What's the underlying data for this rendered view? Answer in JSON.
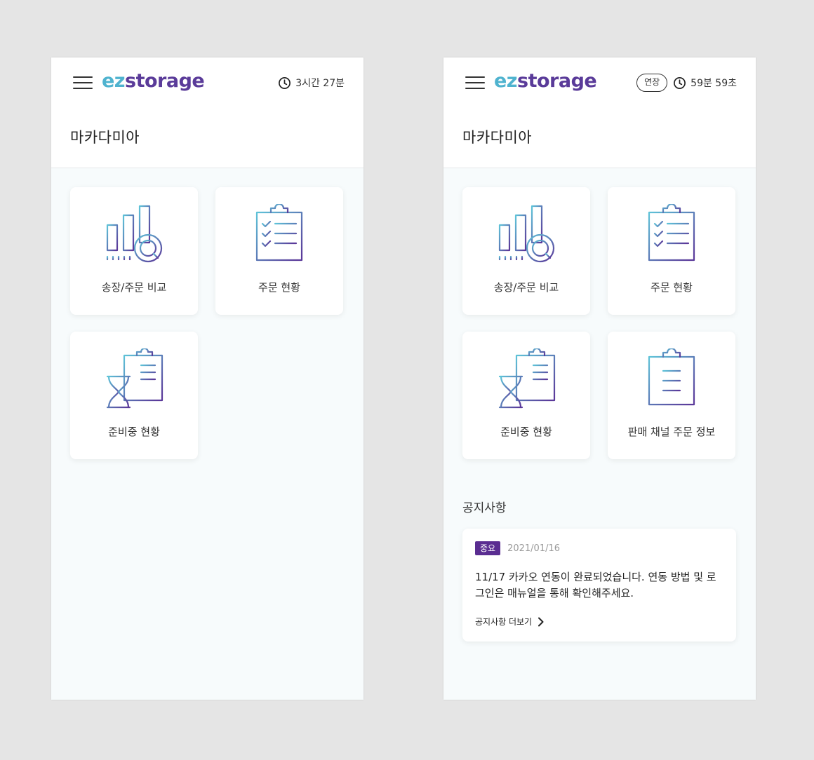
{
  "app": {
    "logo_ez": "ez",
    "logo_storage": "storage"
  },
  "colors": {
    "brand_teal": "#4fb3cf",
    "brand_purple": "#5a3b99",
    "badge_purple": "#5a2d91"
  },
  "left_screen": {
    "timer": "3시간 27분",
    "store_name": "마카다미아",
    "menu": [
      {
        "label": "송장/주문 비교",
        "icon": "bar-chart-search-icon"
      },
      {
        "label": "주문 현황",
        "icon": "clipboard-checklist-icon"
      },
      {
        "label": "준비중 현황",
        "icon": "hourglass-clipboard-icon"
      }
    ]
  },
  "right_screen": {
    "extend_label": "연장",
    "timer": "59분 59초",
    "store_name": "마카다미아",
    "menu": [
      {
        "label": "송장/주문 비교",
        "icon": "bar-chart-search-icon"
      },
      {
        "label": "주문 현황",
        "icon": "clipboard-checklist-icon"
      },
      {
        "label": "준비중 현황",
        "icon": "hourglass-clipboard-icon"
      },
      {
        "label": "판매 채널 주문 정보",
        "icon": "clipboard-lines-icon"
      }
    ],
    "notice": {
      "section_title": "공지사항",
      "badge": "중요",
      "date": "2021/01/16",
      "body": "11/17 카카오 연동이 완료되었습니다. 연동 방법 및 로그인은 매뉴얼을 통해 확인해주세요.",
      "more_label": "공지사항 더보기"
    }
  }
}
